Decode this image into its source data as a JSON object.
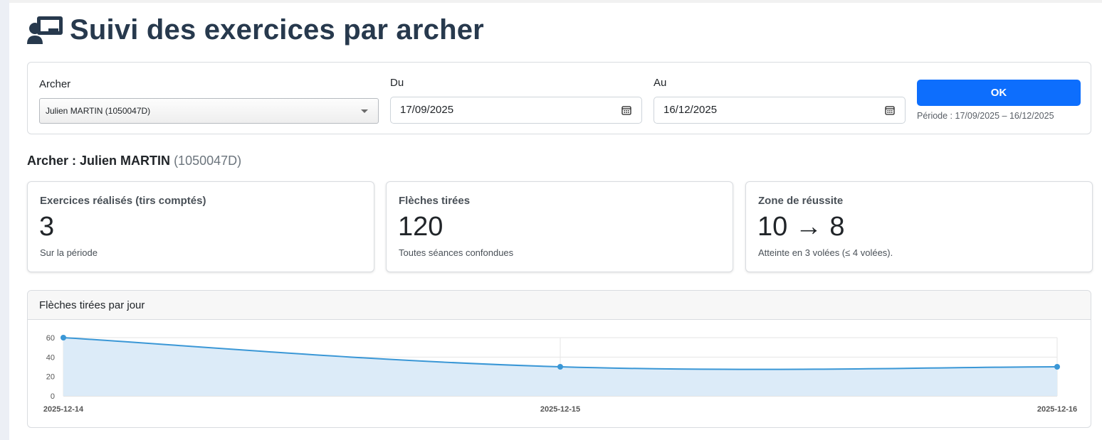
{
  "page": {
    "title": "Suivi des exercices par archer",
    "title_icon": "chalkboard-user-icon"
  },
  "filters": {
    "archer_label": "Archer",
    "archer_selected": "Julien MARTIN (1050047D)",
    "from_label": "Du",
    "from_value": "17/09/2025",
    "to_label": "Au",
    "to_value": "16/12/2025",
    "ok_label": "OK",
    "period_text": "Période : 17/09/2025 – 16/12/2025"
  },
  "archer": {
    "prefix": "Archer : ",
    "name": "Julien MARTIN",
    "id": "(1050047D)"
  },
  "stats": [
    {
      "title": "Exercices réalisés (tirs comptés)",
      "value": "3",
      "sub": "Sur la période"
    },
    {
      "title": "Flèches tirées",
      "value": "120",
      "sub": "Toutes séances confondues"
    },
    {
      "title": "Zone de réussite",
      "value": "10 → 8",
      "sub": "Atteinte en 3 volées (≤ 4 volées)."
    }
  ],
  "colors": {
    "primary": "#0d6efd",
    "title": "#27394d",
    "line": "#3a97d6",
    "fill": "#dcebf8"
  },
  "chart_data": {
    "type": "area",
    "title": "Flèches tirées par jour",
    "x": [
      "2025-12-14",
      "2025-12-15",
      "2025-12-16"
    ],
    "series": [
      {
        "values": [
          60,
          30,
          30
        ]
      }
    ],
    "ylim": [
      0,
      60
    ],
    "yticks": [
      0,
      20,
      40,
      60
    ],
    "grid": true
  }
}
